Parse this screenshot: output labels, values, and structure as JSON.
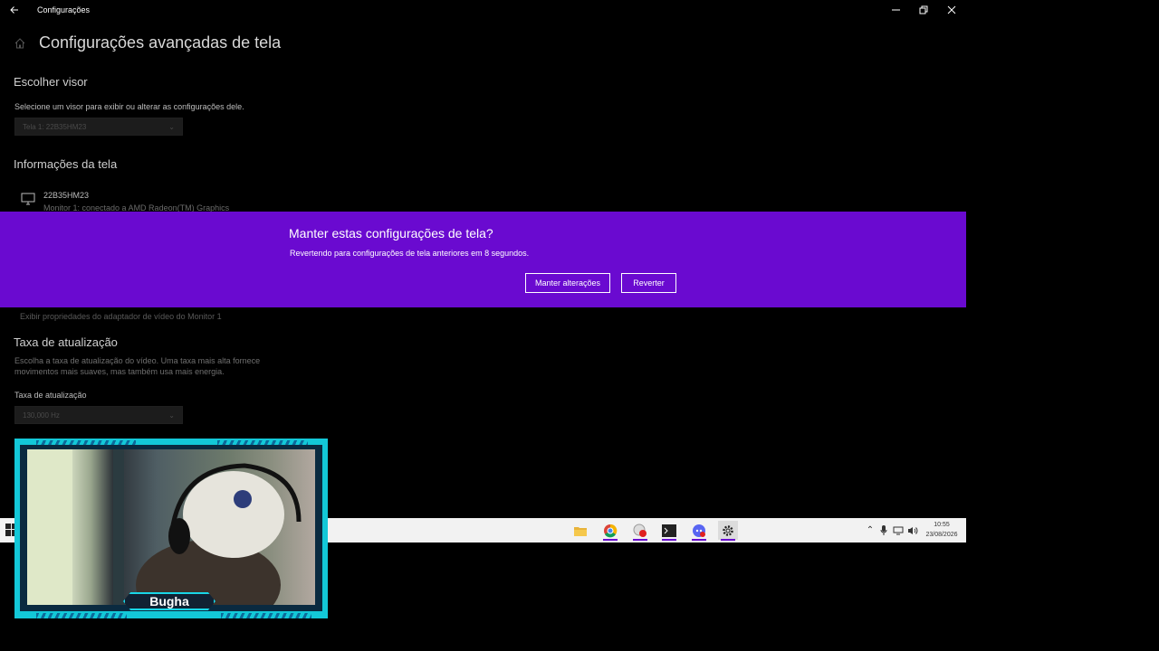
{
  "window": {
    "title": "Configurações",
    "controls": [
      "minimize",
      "restore",
      "close"
    ]
  },
  "page": {
    "title": "Configurações avançadas de tela",
    "choose_display": {
      "heading": "Escolher visor",
      "description": "Selecione um visor para exibir ou alterar as configurações dele.",
      "selected": "Tela 1: 22B35HM23"
    },
    "display_info": {
      "heading": "Informações da tela",
      "monitor_name": "22B35HM23",
      "monitor_detail": "Monitor 1: conectado a AMD Radeon(TM) Graphics",
      "adapter_link": "Exibir propriedades do adaptador de vídeo do Monitor 1"
    },
    "refresh_rate": {
      "heading": "Taxa de atualização",
      "description_line1": "Escolha a taxa de atualização do vídeo. Uma taxa mais alta fornece",
      "description_line2": "movimentos mais suaves, mas também usa mais energia.",
      "label": "Taxa de atualização",
      "selected": "130,000 Hz"
    }
  },
  "dialog": {
    "title": "Manter estas configurações de tela?",
    "message": "Revertendo para configurações de tela anteriores em  8 segundos.",
    "keep_label": "Manter alterações",
    "revert_label": "Reverter"
  },
  "taskbar": {
    "apps": [
      "file-explorer",
      "chrome",
      "recorder",
      "terminal",
      "discord",
      "settings"
    ],
    "clock_time": "10:55",
    "clock_date": "23/08/2026"
  },
  "webcam": {
    "name": "Bugha"
  },
  "colors": {
    "banner": "#6a0ad0",
    "cam_frame": "#13c8d8"
  }
}
